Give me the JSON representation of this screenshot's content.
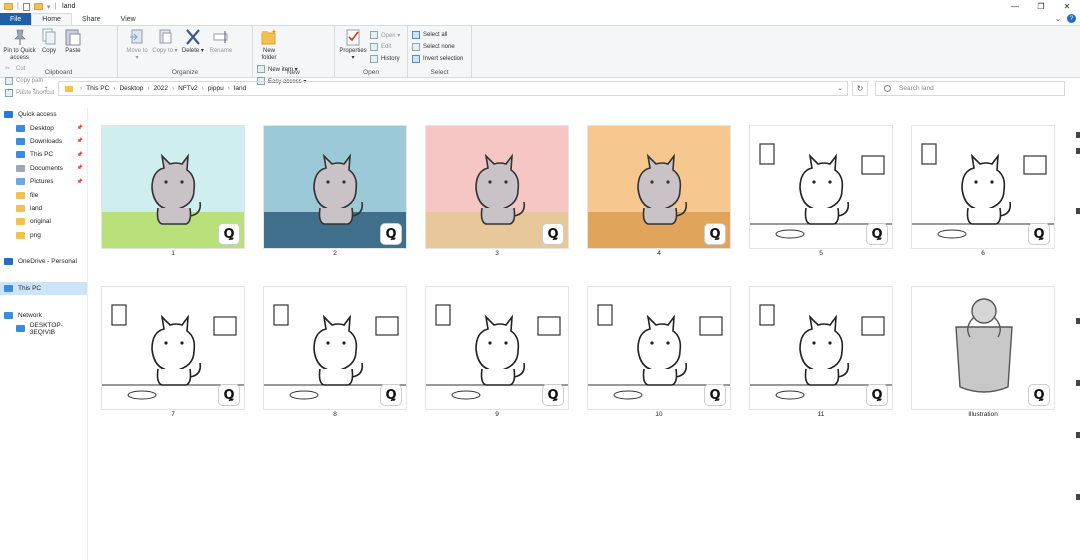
{
  "window": {
    "title": "land",
    "controls": {
      "minimize": "—",
      "maximize": "❐",
      "close": "✕"
    }
  },
  "tabs": [
    {
      "label": "File"
    },
    {
      "label": "Home"
    },
    {
      "label": "Share"
    },
    {
      "label": "View"
    }
  ],
  "help": {
    "expand": "⌄",
    "icon": "?"
  },
  "ribbon": {
    "clipboard": {
      "label": "Clipboard",
      "pin": "Pin to Quick access",
      "copy": "Copy",
      "paste": "Paste",
      "cut": "Cut",
      "copy_path": "Copy path",
      "paste_shortcut": "Paste shortcut"
    },
    "organize": {
      "label": "Organize",
      "move_to": "Move to ▾",
      "copy_to": "Copy to ▾",
      "delete": "Delete ▾",
      "rename": "Rename"
    },
    "new": {
      "label": "New",
      "new_folder": "New folder",
      "new_item": "New item ▾",
      "easy_access": "Easy access ▾"
    },
    "open": {
      "label": "Open",
      "properties": "Properties ▾",
      "open": "Open ▾",
      "edit": "Edit",
      "history": "History"
    },
    "select": {
      "label": "Select",
      "select_all": "Select all",
      "select_none": "Select none",
      "invert": "Invert selection"
    }
  },
  "address": {
    "crumbs": [
      "This PC",
      "Desktop",
      "2022",
      "NFTv2",
      "pippu",
      "land"
    ],
    "search_placeholder": "Search land"
  },
  "nav": [
    {
      "label": "Quick access",
      "icon": "star-icon",
      "color": "#2b79d6",
      "pinned": false,
      "indent": 4
    },
    {
      "label": "Desktop",
      "icon": "desktop-folder-icon",
      "color": "#3b8be0",
      "pinned": true,
      "indent": 16
    },
    {
      "label": "Downloads",
      "icon": "downloads-icon",
      "color": "#3b8be0",
      "pinned": true,
      "indent": 16
    },
    {
      "label": "This PC",
      "icon": "computer-icon",
      "color": "#3b8be0",
      "pinned": true,
      "indent": 16
    },
    {
      "label": "Documents",
      "icon": "documents-icon",
      "color": "#9aa7b5",
      "pinned": true,
      "indent": 16
    },
    {
      "label": "Pictures",
      "icon": "pictures-icon",
      "color": "#6aa8e8",
      "pinned": true,
      "indent": 16
    },
    {
      "label": "file",
      "icon": "folder-icon",
      "color": "#f2c14e",
      "pinned": false,
      "indent": 16
    },
    {
      "label": "land",
      "icon": "folder-icon",
      "color": "#f2c14e",
      "pinned": false,
      "indent": 16
    },
    {
      "label": "original",
      "icon": "folder-icon",
      "color": "#f2c14e",
      "pinned": false,
      "indent": 16
    },
    {
      "label": "png",
      "icon": "folder-icon",
      "color": "#f2c14e",
      "pinned": false,
      "indent": 16
    },
    {
      "label": "",
      "icon": "",
      "color": "",
      "pinned": false,
      "indent": 0
    },
    {
      "label": "OneDrive - Personal",
      "icon": "onedrive-icon",
      "color": "#1e6fc9",
      "pinned": false,
      "indent": 4
    },
    {
      "label": "",
      "icon": "",
      "color": "",
      "pinned": false,
      "indent": 0
    },
    {
      "label": "This PC",
      "icon": "computer-icon",
      "color": "#3b8be0",
      "pinned": false,
      "indent": 4,
      "selected": true
    },
    {
      "label": "",
      "icon": "",
      "color": "",
      "pinned": false,
      "indent": 0
    },
    {
      "label": "Network",
      "icon": "network-icon",
      "color": "#3b8be0",
      "pinned": false,
      "indent": 4
    },
    {
      "label": "DESKTOP-3EQIVIB",
      "icon": "computer-icon",
      "color": "#3b8be0",
      "pinned": false,
      "indent": 16
    }
  ],
  "files": [
    {
      "name": "1",
      "style": "color",
      "bg": "#cfeef0",
      "floor": "#b9e07a"
    },
    {
      "name": "2",
      "style": "color",
      "bg": "#9cc9d8",
      "floor": "#3f6f8a"
    },
    {
      "name": "3",
      "style": "color",
      "bg": "#f6c6c4",
      "floor": "#e8c89a"
    },
    {
      "name": "4",
      "style": "color",
      "bg": "#f6c890",
      "floor": "#e0a45a"
    },
    {
      "name": "5",
      "style": "line"
    },
    {
      "name": "6",
      "style": "line"
    },
    {
      "name": "7",
      "style": "line"
    },
    {
      "name": "8",
      "style": "line"
    },
    {
      "name": "9",
      "style": "line"
    },
    {
      "name": "10",
      "style": "line"
    },
    {
      "name": "11",
      "style": "line"
    },
    {
      "name": "Illustration",
      "style": "gray"
    }
  ],
  "badge_glyph": "Ꝗ"
}
